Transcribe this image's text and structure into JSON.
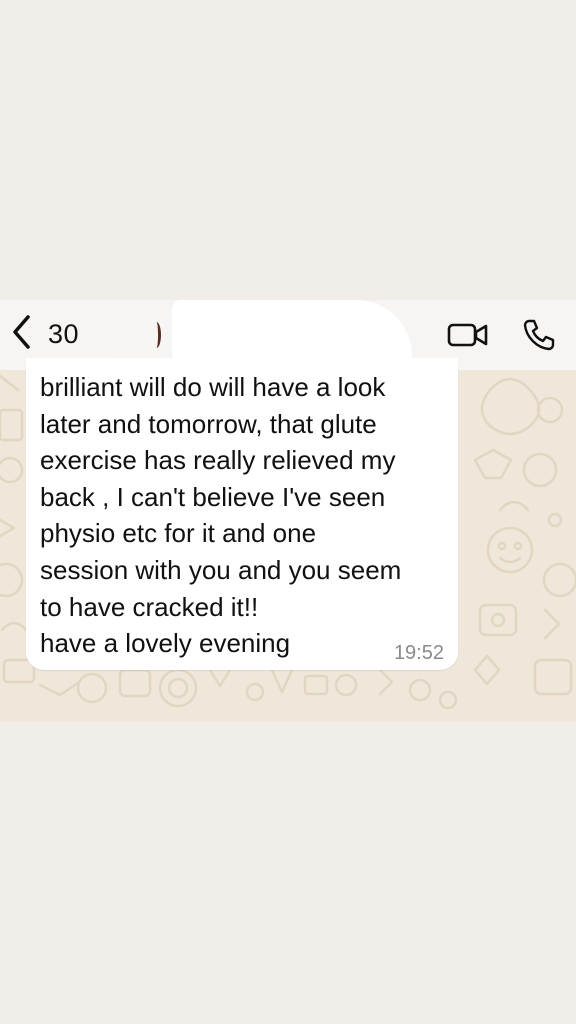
{
  "header": {
    "back_count": "30",
    "contact_name": "",
    "actions": [
      {
        "icon": "video-camera-icon"
      },
      {
        "icon": "phone-icon"
      }
    ]
  },
  "message": {
    "text": "brilliant will do will have a look\nlater and tomorrow, that glute\nexercise has really relieved my\nback , I can't believe I've seen\nphysio etc for it and one\nsession with you and you seem\nto have cracked it!!\nhave a lovely evening",
    "time": "19:52",
    "direction": "incoming"
  },
  "colors": {
    "page_bg": "#f1eee9",
    "chat_bg": "#efe7da",
    "bubble": "#ffffff",
    "timestamp": "#8a8a8a"
  }
}
